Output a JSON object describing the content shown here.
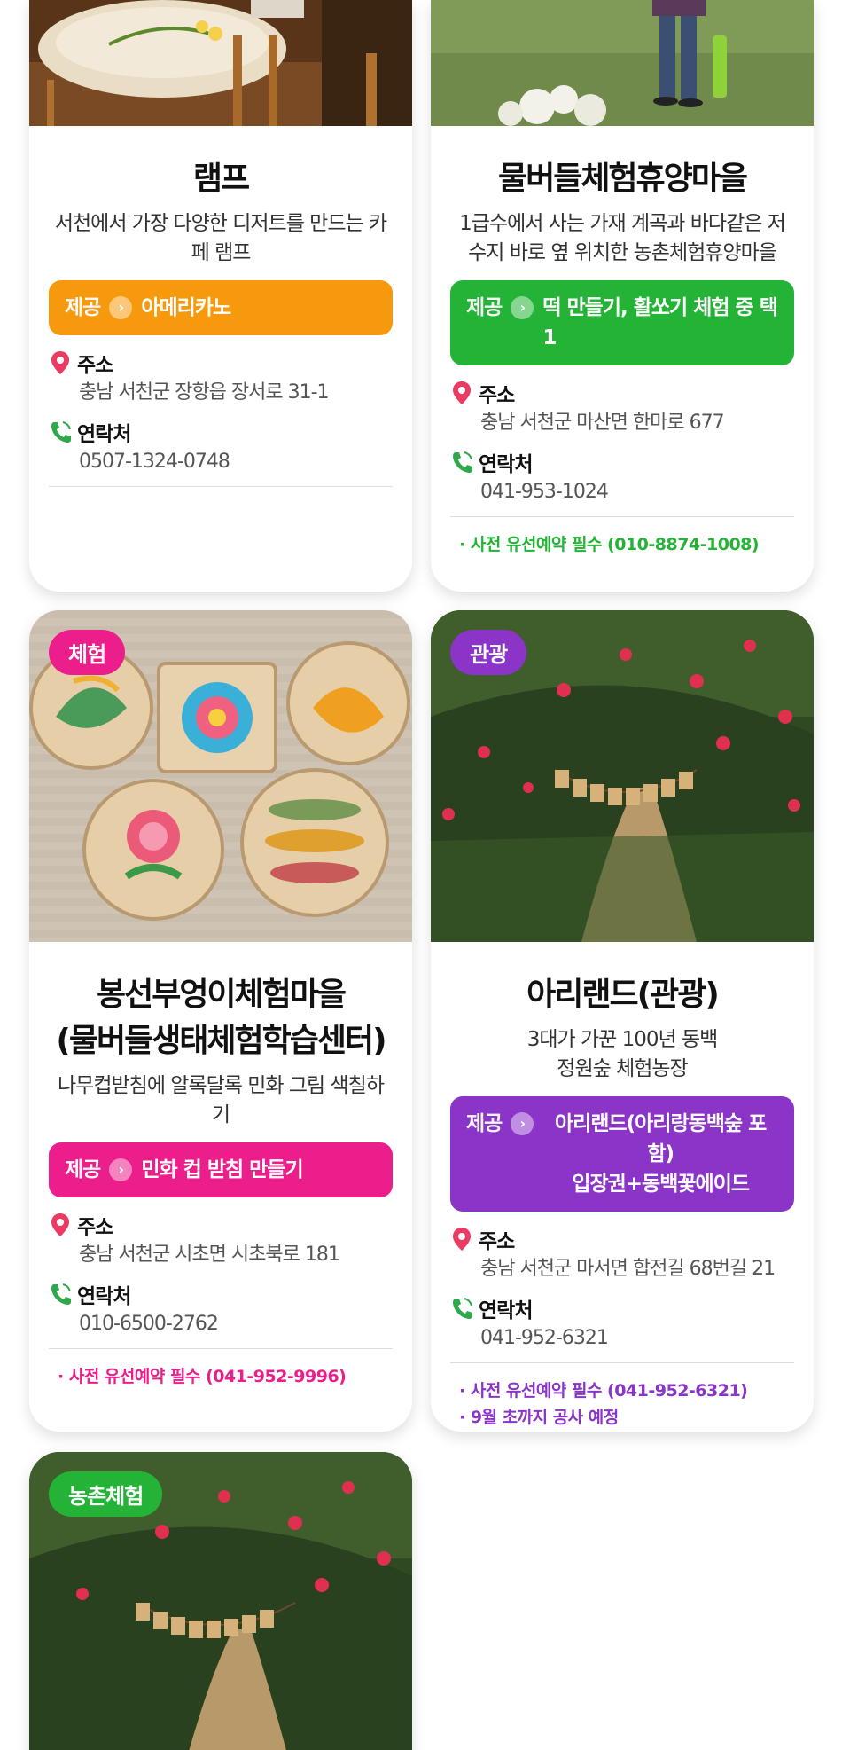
{
  "common": {
    "offer_label": "제공",
    "address_label": "주소",
    "contact_label": "연락처"
  },
  "cards": [
    {
      "title": "램프",
      "desc": "서천에서 가장 다양한 디저트를 만드는 카페 램프",
      "offer": "아메리카노",
      "address": "충남 서천군 장항읍 장서로 31-1",
      "contact": "0507-1324-0748",
      "color": "#f7990c"
    },
    {
      "title": "물버들체험휴양마을",
      "desc": "1급수에서 사는 가재 계곡과 바다같은 저수지 바로 옆 위치한 농촌체험휴양마을",
      "offer": "떡 만들기, 활쏘기 체험 중 택 1",
      "address": "충남 서천군 마산면 한마로 677",
      "contact": "041-953-1024",
      "notes": [
        "· 사전 유선예약 필수 (010-8874-1008)"
      ],
      "color": "#24b337"
    },
    {
      "badge": "체험",
      "title_line1": "봉선부엉이체험마을",
      "title_line2": "(물버들생태체험학습센터)",
      "desc": "나무컵받침에 알록달록 민화 그림 색칠하기",
      "offer": "민화 컵 받침 만들기",
      "address": "충남 서천군 시초면 시초북로 181",
      "contact": "010-6500-2762",
      "notes": [
        "· 사전 유선예약 필수 (041-952-9996)"
      ],
      "color": "#ec1e8c"
    },
    {
      "badge": "관광",
      "title": "아리랜드(관광)",
      "desc_line1": "3대가 가꾼 100년 동백",
      "desc_line2": "정원숲 체험농장",
      "offer_line1": "아리랜드(아리랑동백숲 포함)",
      "offer_line2": "입장권+동백꽃에이드",
      "address": "충남 서천군 마서면 합전길 68번길 21",
      "contact": "041-952-6321",
      "notes": [
        "· 사전 유선예약 필수 (041-952-6321)",
        "· 9월 초까지 공사 예정"
      ],
      "color": "#8a35c8"
    },
    {
      "badge": "농촌체험",
      "color": "#24b337"
    }
  ]
}
